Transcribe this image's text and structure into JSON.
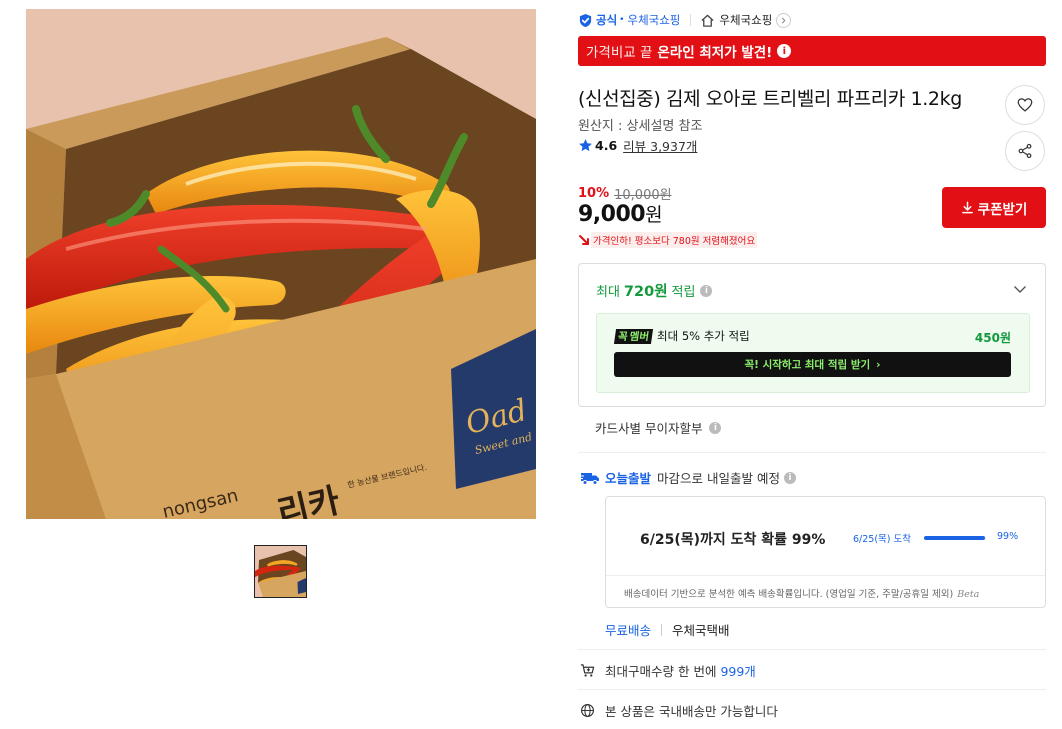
{
  "store": {
    "official_label": "공식",
    "official_store_link": "우체국쇼핑",
    "store_name": "우체국쇼핑"
  },
  "price_banner": {
    "prefix": "가격비교 끝",
    "highlight": "온라인 최저가 발견!",
    "info_glyph": "i"
  },
  "product": {
    "title": "(신선집중) 김제 오아로 트리벨리 파프리카 1.2kg",
    "origin": "원산지 : 상세설명 참조",
    "rating": "4.6",
    "review_text": "리뷰 3,937개"
  },
  "price": {
    "discount_rate": "10%",
    "original_price": "10,000원",
    "sale_price_number": "9,000",
    "sale_price_unit": "원",
    "price_drop_note": "가격인하! 평소보다 780원 저렴해졌어요"
  },
  "coupon_button": "쿠폰받기",
  "points": {
    "prefix": "최대",
    "amount": "720원",
    "suffix": "적립",
    "member_logo_a": "꼭",
    "member_logo_b": "멤버",
    "member_text": "최대 5% 추가 적립",
    "member_amount": "450원",
    "member_cta": "꼭! 시작하고 최대 적립 받기",
    "member_cta_arrow": "›"
  },
  "card_installment": "카드사별 무이자할부",
  "delivery": {
    "today_label": "오늘출발",
    "deadline_text": "마감으로 내일출발 예정",
    "arrival_main": "6/25(목)까지 도착 확률 99%",
    "arrival_mini_date": "6/25(목) 도착",
    "arrival_percent_text": "99%",
    "arrival_probability": 0.99,
    "note": "배송데이터 기반으로 분석한 예측 배송확률입니다. (영업일 기준, 주말/공휴일 제외)",
    "beta": "Beta",
    "free_shipping": "무료배송",
    "carrier": "우체국택배"
  },
  "purchase_limit": {
    "text": "최대구매수량 한 번에",
    "qty": "999개"
  },
  "domestic_only": "본 상품은 국내배송만 가능합니다",
  "photo": {
    "box_brand": "nongsan",
    "box_label": "리카",
    "box_fine_print": "한 농산물 브랜드입니다.",
    "box_sticker_text": "Oad",
    "box_sticker_sub": "Sweet and"
  },
  "colors": {
    "accent_red": "#e20f14",
    "link_blue": "#1a63e5",
    "points_green": "#129a3c",
    "member_neon": "#8ef06e"
  },
  "icons": {
    "official": "shield-check-icon",
    "home": "home-icon",
    "heart": "heart-icon",
    "share": "share-icon",
    "star": "star-icon",
    "download": "download-icon",
    "chevron": "chevron-down-icon",
    "truck": "truck-icon",
    "cart": "cart-icon",
    "globe": "globe-icon"
  }
}
